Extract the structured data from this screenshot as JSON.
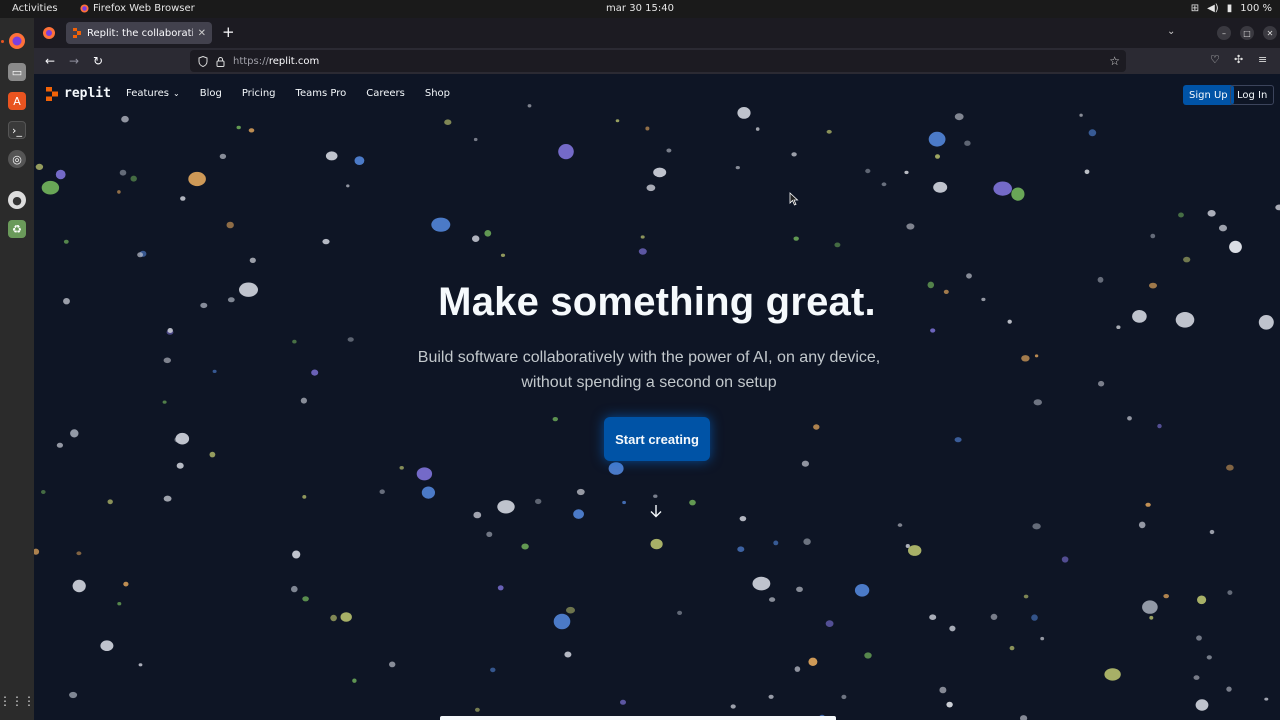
{
  "system": {
    "activities": "Activities",
    "app_name": "Firefox Web Browser",
    "clock": "mar 30  15:40",
    "battery": "100 %"
  },
  "browser": {
    "tab_title": "Replit: the collaborative",
    "url_protocol": "https://",
    "url_domain": "replit.com"
  },
  "site": {
    "logo_text": "replit",
    "nav": [
      "Features",
      "Blog",
      "Pricing",
      "Teams Pro",
      "Careers",
      "Shop"
    ],
    "signup": "Sign Up",
    "login": "Log In",
    "hero_title": "Make something great.",
    "hero_subtitle": "Build software collaboratively with the power of AI, on any device, without spending a second on setup",
    "cta": "Start creating"
  },
  "colors": {
    "page_bg": "#0e1525",
    "primary_button": "#0053a6",
    "text": "#f5f9fc",
    "subtext": "#c2c8cc",
    "logo_accent": "#f26207"
  },
  "icons": [
    "firefox-icon",
    "lock-icon",
    "shield-icon",
    "star-icon",
    "pocket-icon",
    "extensions-icon",
    "hamburger-icon",
    "back-arrow-icon",
    "forward-arrow-icon",
    "reload-icon",
    "chevron-down-icon",
    "arrow-down-icon"
  ]
}
